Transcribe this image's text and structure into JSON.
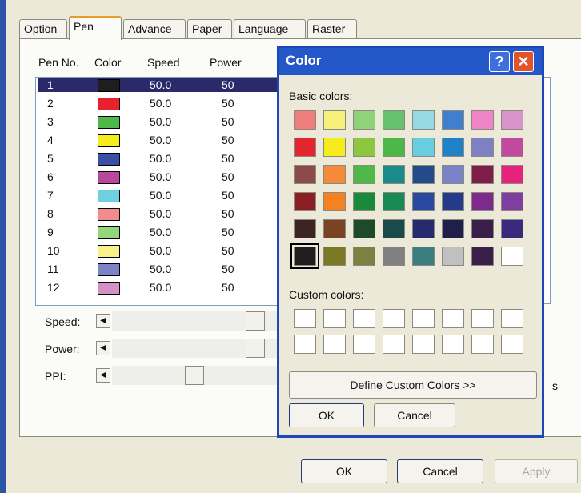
{
  "tabs": [
    "Option",
    "Pen",
    "Advance",
    "Paper",
    "Language",
    "Raster"
  ],
  "columns": {
    "pen_no": "Pen No.",
    "color": "Color",
    "speed": "Speed",
    "power": "Power"
  },
  "pens": [
    {
      "no": "1",
      "color": "#1e1e1e",
      "speed": "50.0",
      "power": "50"
    },
    {
      "no": "2",
      "color": "#e8222c",
      "speed": "50.0",
      "power": "50"
    },
    {
      "no": "3",
      "color": "#4fb84a",
      "speed": "50.0",
      "power": "50"
    },
    {
      "no": "4",
      "color": "#f5ec1a",
      "speed": "50.0",
      "power": "50"
    },
    {
      "no": "5",
      "color": "#3a4fa8",
      "speed": "50.0",
      "power": "50"
    },
    {
      "no": "6",
      "color": "#b8489e",
      "speed": "50.0",
      "power": "50"
    },
    {
      "no": "7",
      "color": "#6ecfe0",
      "speed": "50.0",
      "power": "50"
    },
    {
      "no": "8",
      "color": "#f08c8c",
      "speed": "50.0",
      "power": "50"
    },
    {
      "no": "9",
      "color": "#94d67a",
      "speed": "50.0",
      "power": "50"
    },
    {
      "no": "10",
      "color": "#f8f08a",
      "speed": "50.0",
      "power": "50"
    },
    {
      "no": "11",
      "color": "#7c84c8",
      "speed": "50.0",
      "power": "50"
    },
    {
      "no": "12",
      "color": "#d690c8",
      "speed": "50.0",
      "power": "50"
    }
  ],
  "sliders": [
    {
      "label": "Speed:",
      "thumb_pct": 0.92
    },
    {
      "label": "Power:",
      "thumb_pct": 0.92
    },
    {
      "label": "PPI:",
      "thumb_pct": 0.5
    }
  ],
  "buttons": {
    "ok": "OK",
    "cancel": "Cancel",
    "apply": "Apply"
  },
  "side_clip_text": "s",
  "color_dialog": {
    "title": "Color",
    "help": "?",
    "close": "✕",
    "basic_label": "Basic colors:",
    "basic_colors": [
      [
        "#f07e7e",
        "#f7f07a",
        "#8fd27a",
        "#66c26e",
        "#96d8e3",
        "#3f7fcf",
        "#ef84c6",
        "#d894c8"
      ],
      [
        "#e3262d",
        "#f6eb1d",
        "#8dc63f",
        "#4db848",
        "#66cee0",
        "#1f82c6",
        "#7f80c3",
        "#c24a9e"
      ],
      [
        "#8c4a48",
        "#f58a3a",
        "#50b847",
        "#1a8a8a",
        "#244a8a",
        "#7a82c8",
        "#7e1f4a",
        "#e6237c"
      ],
      [
        "#8a1f24",
        "#f58220",
        "#1a8a3a",
        "#1a8a55",
        "#2a4aa0",
        "#263a8a",
        "#7e2a8c",
        "#7f3fa0"
      ],
      [
        "#3d2424",
        "#7a4424",
        "#1f4a2a",
        "#1a4a4a",
        "#262a6e",
        "#1f1f4a",
        "#3a1f4a",
        "#3a2a7e"
      ],
      [
        "#1e1e1e",
        "#7a7a24",
        "#7f7f40",
        "#808080",
        "#3a7e80",
        "#c0c0c0",
        "#3a1f4a",
        "#ffffff"
      ]
    ],
    "selected_basic": [
      5,
      0
    ],
    "custom_label": "Custom colors:",
    "define_button": "Define Custom Colors >>",
    "ok": "OK",
    "cancel": "Cancel"
  }
}
